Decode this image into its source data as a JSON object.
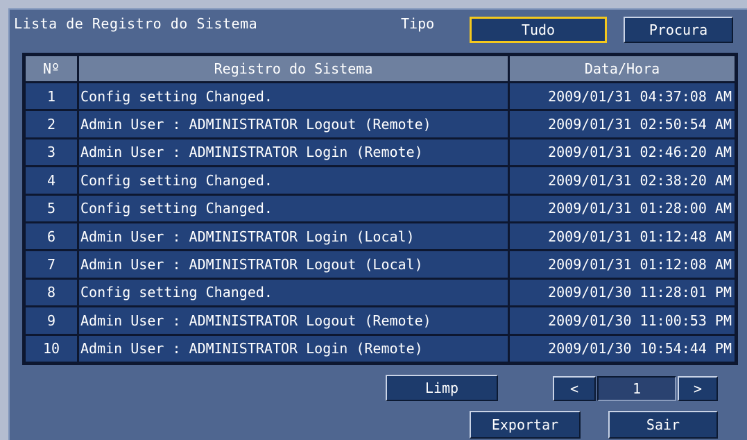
{
  "header": {
    "title": "Lista de Registro do Sistema",
    "tipo_label": "Tipo",
    "tipo_value": "Tudo",
    "search_label": "Procura"
  },
  "table": {
    "columns": [
      "Nº",
      "Registro do Sistema",
      "Data/Hora"
    ],
    "rows": [
      {
        "no": "1",
        "message": "Config setting Changed.",
        "datetime": "2009/01/31 04:37:08 AM"
      },
      {
        "no": "2",
        "message": "Admin User : ADMINISTRATOR Logout (Remote)",
        "datetime": "2009/01/31 02:50:54 AM"
      },
      {
        "no": "3",
        "message": "Admin User : ADMINISTRATOR Login (Remote)",
        "datetime": "2009/01/31 02:46:20 AM"
      },
      {
        "no": "4",
        "message": "Config setting Changed.",
        "datetime": "2009/01/31 02:38:20 AM"
      },
      {
        "no": "5",
        "message": "Config setting Changed.",
        "datetime": "2009/01/31 01:28:00 AM"
      },
      {
        "no": "6",
        "message": "Admin User : ADMINISTRATOR Login (Local)",
        "datetime": "2009/01/31 01:12:48 AM"
      },
      {
        "no": "7",
        "message": "Admin User : ADMINISTRATOR Logout (Local)",
        "datetime": "2009/01/31 01:12:08 AM"
      },
      {
        "no": "8",
        "message": "Config setting Changed.",
        "datetime": "2009/01/30 11:28:01 PM"
      },
      {
        "no": "9",
        "message": "Admin User : ADMINISTRATOR Logout (Remote)",
        "datetime": "2009/01/30 11:00:53 PM"
      },
      {
        "no": "10",
        "message": "Admin User : ADMINISTRATOR Login (Remote)",
        "datetime": "2009/01/30 10:54:44 PM"
      }
    ]
  },
  "footer": {
    "clear_label": "Limp",
    "prev_label": "<",
    "page": "1",
    "next_label": ">",
    "export_label": "Exportar",
    "exit_label": "Sair"
  },
  "colors": {
    "panel": "#4f6690",
    "button": "#1d3b6c",
    "selected_border": "#f4c81d",
    "row": "#23427a",
    "header_cell": "#6e809f"
  }
}
